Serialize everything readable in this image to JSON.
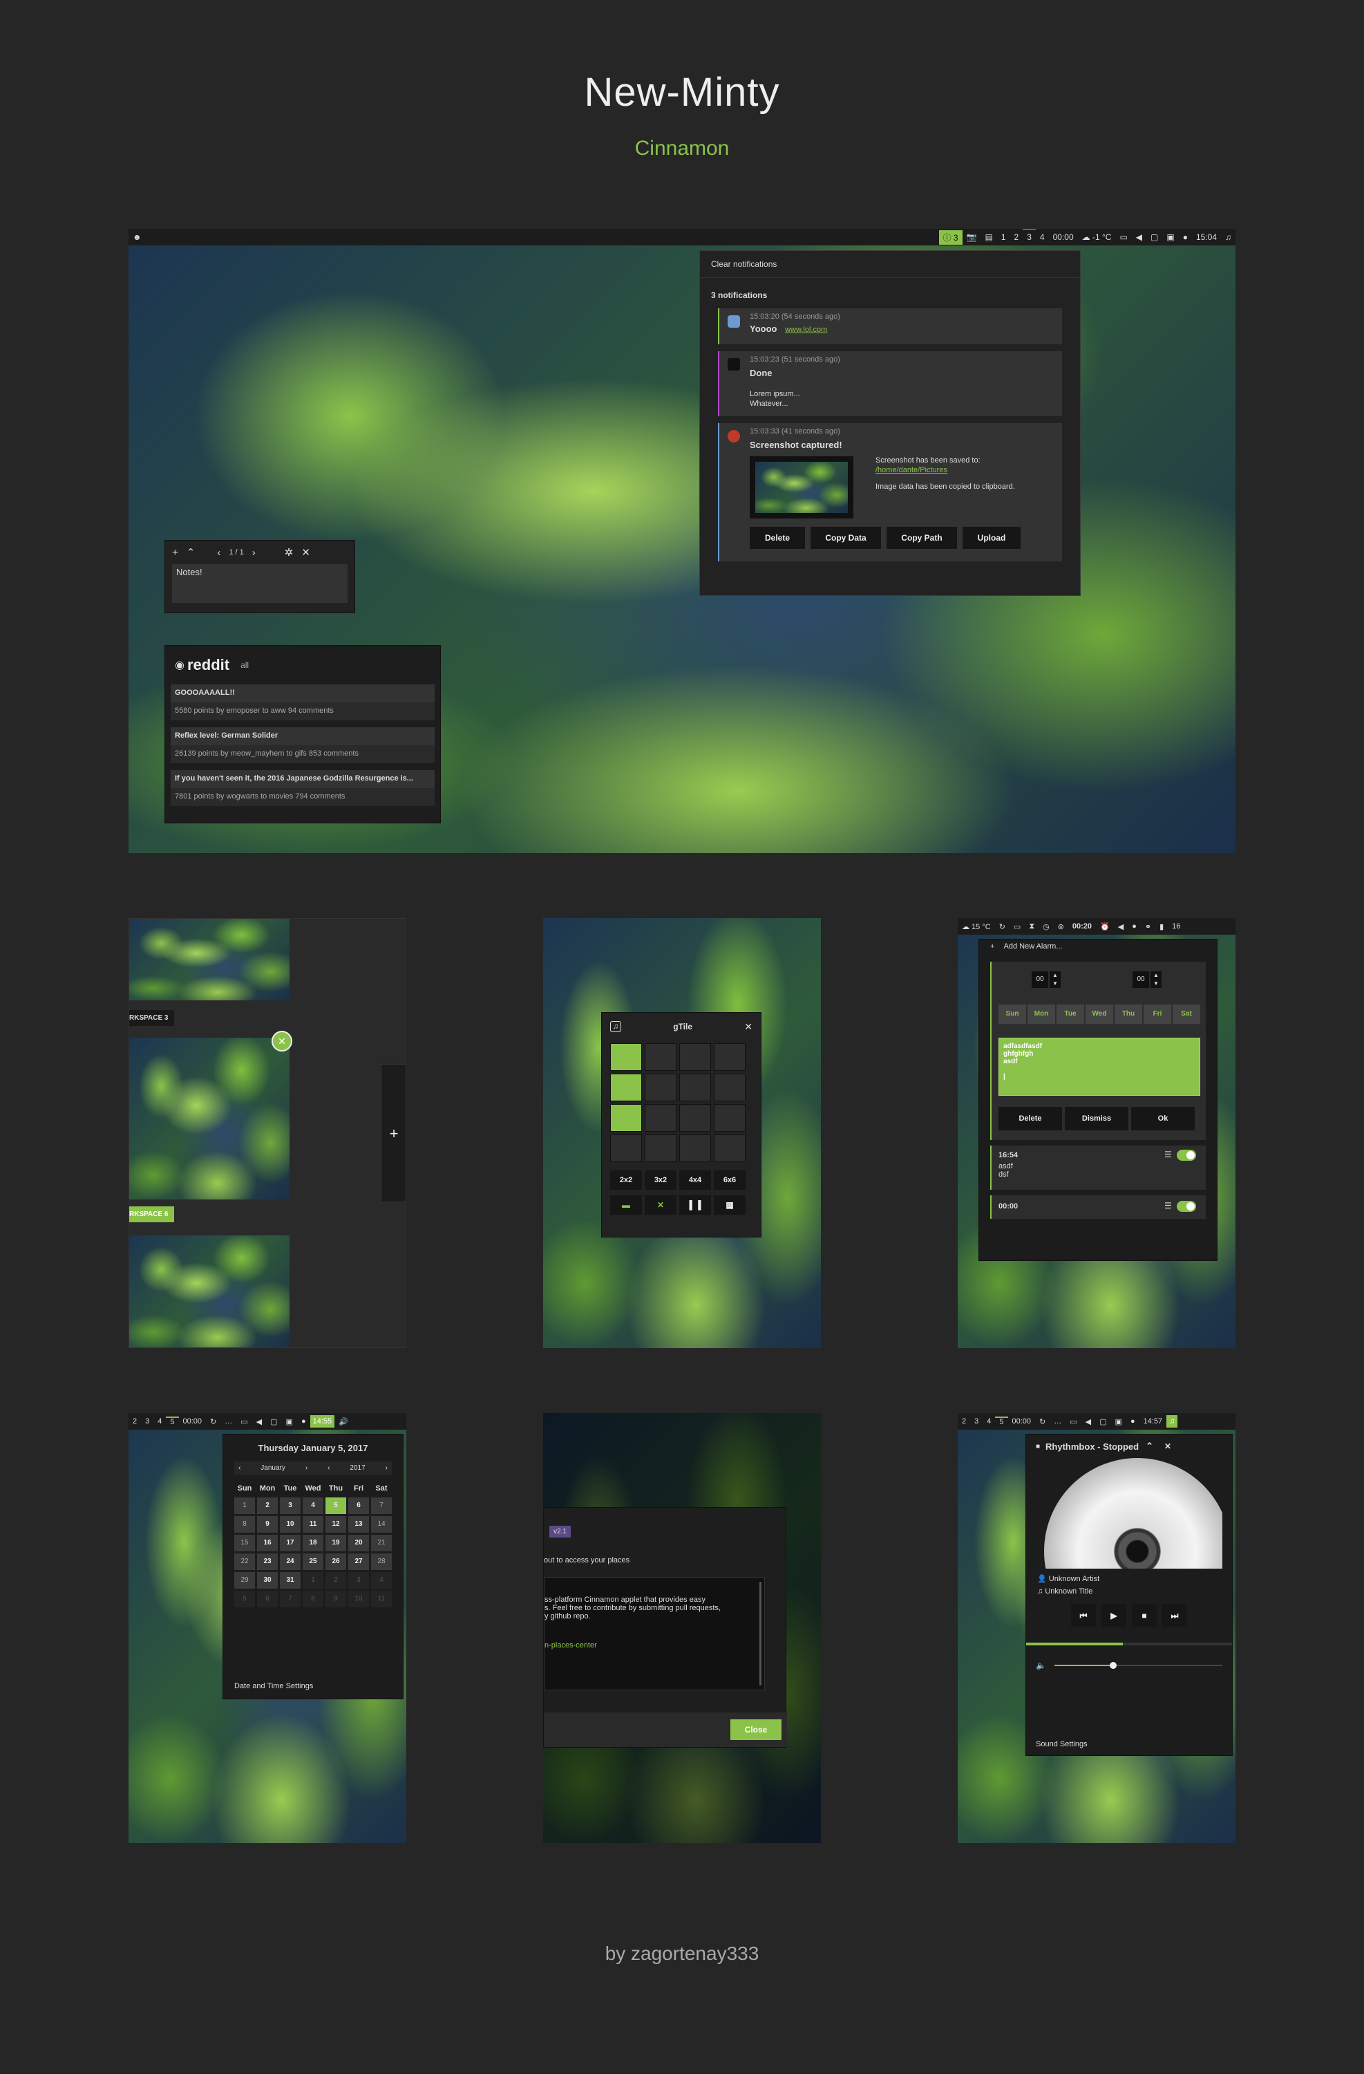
{
  "header": {
    "title": "New-Minty",
    "subtitle": "Cinnamon"
  },
  "footer": {
    "credit": "by zagortenay333"
  },
  "main_panel": {
    "notif_count": "3",
    "workspaces": [
      "1",
      "2",
      "3",
      "4"
    ],
    "timer": "00:00",
    "weather": "-1 °C",
    "clock": "15:04"
  },
  "notifications": {
    "clear": "Clear notifications",
    "count": "3 notifications",
    "items": [
      {
        "time": "15:03:20 (54 seconds ago)",
        "title": "Yoooo",
        "link": "www.lol.com"
      },
      {
        "time": "15:03:23 (51 seconds ago)",
        "title": "Done",
        "body1": "Lorem ipsum...",
        "body2": "Whatever..."
      },
      {
        "time": "15:03:33 (41 seconds ago)",
        "title": "Screenshot captured!",
        "saved": "Screenshot has been saved to:",
        "path": "/home/dante/Pictures",
        "copied": "Image data has been copied to clipboard.",
        "buttons": [
          "Delete",
          "Copy Data",
          "Copy Path",
          "Upload"
        ]
      }
    ]
  },
  "notes": {
    "pager": "1 / 1",
    "text": "Notes!"
  },
  "reddit": {
    "brand": "reddit",
    "sub": "all",
    "posts": [
      {
        "title": "GOOOAAAALL!!",
        "meta": "5580 points by emoposer to aww 94 comments"
      },
      {
        "title": "Reflex level: German Solider",
        "meta": "26139 points by meow_mayhem to gifs 853 comments"
      },
      {
        "title": "If you haven't seen it, the 2016 Japanese Godzilla Resurgence is...",
        "meta": "7801 points by wogwarts to movies 794 comments"
      }
    ]
  },
  "workspaces": {
    "ws3": "RKSPACE 3",
    "ws6": "RKSPACE 6",
    "add": "+"
  },
  "gtile": {
    "title": "gTile",
    "presets": [
      "2x2",
      "3x2",
      "4x4",
      "6x6"
    ],
    "grid_fill": [
      1,
      0,
      0,
      0,
      1,
      0,
      0,
      0,
      1,
      0,
      0,
      0,
      0,
      0,
      0,
      0
    ],
    "close_sym": "✕"
  },
  "alarm": {
    "weather": "15 °C",
    "timer": "00:20",
    "edge": "16",
    "add": "Add New Alarm...",
    "hours": "00",
    "minutes": "00",
    "days": [
      "Sun",
      "Mon",
      "Tue",
      "Wed",
      "Thu",
      "Fri",
      "Sat"
    ],
    "note_lines": [
      "adfasdfasdf",
      "ghfghfgh",
      "asdf",
      "",
      "|"
    ],
    "buttons": [
      "Delete",
      "Dismiss",
      "Ok"
    ],
    "alarms": [
      {
        "time": "16:54",
        "lines": [
          "asdf",
          "dsf"
        ]
      },
      {
        "time": "00:00",
        "lines": []
      }
    ]
  },
  "calendar": {
    "ws": [
      "2",
      "3",
      "4",
      "5"
    ],
    "timer": "00:00",
    "clock": "14:55",
    "date": "Thursday January 5, 2017",
    "month": "January",
    "year": "2017",
    "days": [
      "Sun",
      "Mon",
      "Tue",
      "Wed",
      "Thu",
      "Fri",
      "Sat"
    ],
    "weeks": [
      [
        "1",
        "2",
        "3",
        "4",
        "5",
        "6",
        "7"
      ],
      [
        "8",
        "9",
        "10",
        "11",
        "12",
        "13",
        "14"
      ],
      [
        "15",
        "16",
        "17",
        "18",
        "19",
        "20",
        "21"
      ],
      [
        "22",
        "23",
        "24",
        "25",
        "26",
        "27",
        "28"
      ],
      [
        "29",
        "30",
        "31",
        "1",
        "2",
        "3",
        "4"
      ],
      [
        "5",
        "6",
        "7",
        "8",
        "9",
        "10",
        "11"
      ]
    ],
    "today": "5",
    "settings": "Date and Time Settings"
  },
  "about": {
    "version": "v2.1",
    "desc1": "out to access your places",
    "desc2": "ss-platform Cinnamon applet that provides easy",
    "desc3": "s. Feel free to contribute by submitting pull requests,",
    "desc4": "y github repo.",
    "link": "n-places-center",
    "close": "Close"
  },
  "player": {
    "ws": [
      "2",
      "3",
      "4",
      "5"
    ],
    "timer": "00:00",
    "clock": "14:57",
    "title": "Rhythmbox - Stopped",
    "artist": "Unknown Artist",
    "track": "Unknown Title",
    "volume": 0.35,
    "settings": "Sound Settings"
  },
  "colors": {
    "accent": "#8bc34a",
    "panel": "#1c1c1c",
    "bg": "#262626"
  }
}
